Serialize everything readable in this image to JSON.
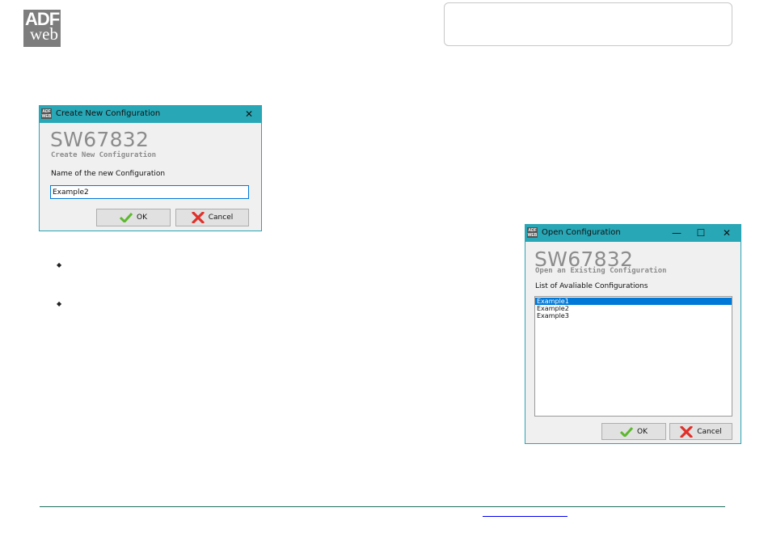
{
  "logo": {
    "line1": "ADF",
    "line2": "web"
  },
  "create_dialog": {
    "window_title": "Create New Configuration",
    "app_name": "SW67832",
    "subtitle": "Create New Configuration",
    "field_label": "Name of the new Configuration",
    "field_value": "Example2",
    "ok_label": "OK",
    "cancel_label": "Cancel",
    "close_icon": "close-icon"
  },
  "open_dialog": {
    "window_title": "Open Configuration",
    "app_name": "SW67832",
    "subtitle": "Open an Existing Configuration",
    "list_label": "List of Avaliable Configurations",
    "items": [
      "Example1",
      "Example2",
      "Example3"
    ],
    "selected_index": 0,
    "ok_label": "OK",
    "cancel_label": "Cancel"
  },
  "colors": {
    "titlebar": "#28a7b6",
    "selection": "#0078d7",
    "footer_line": "#1e6f5c"
  }
}
